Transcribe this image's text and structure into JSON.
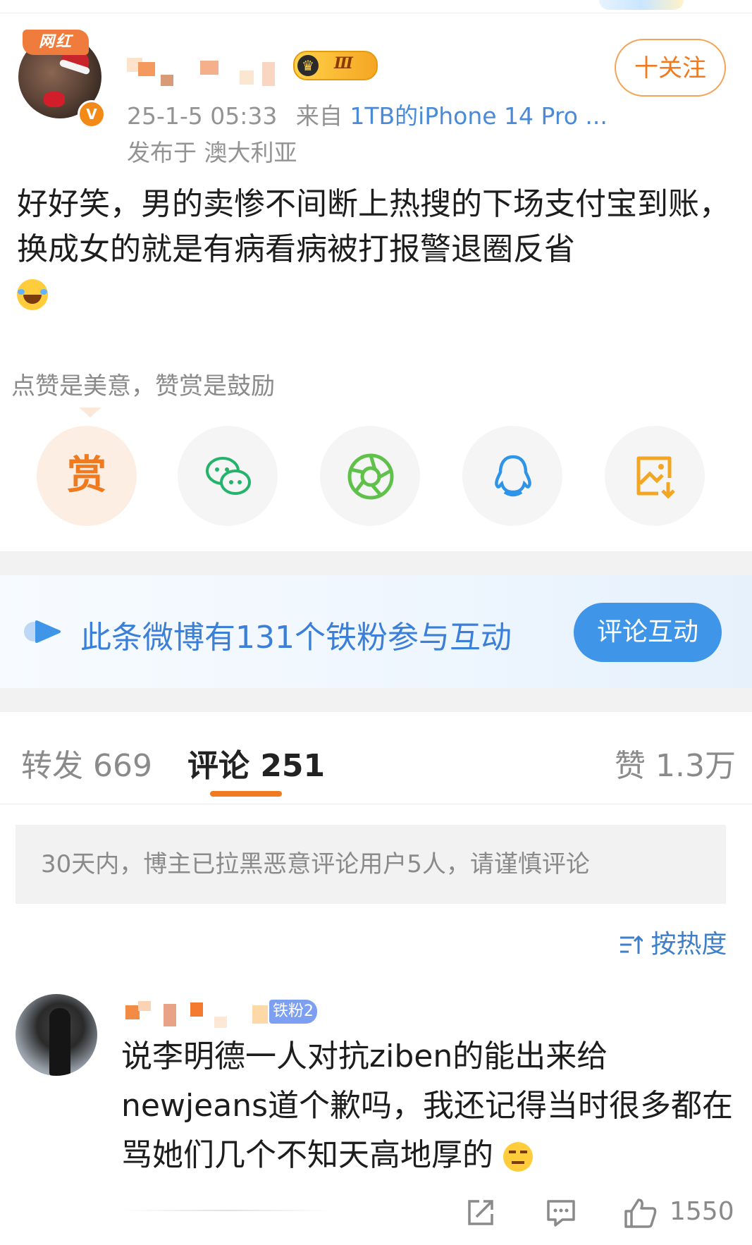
{
  "post": {
    "author_badge": "网红",
    "verified_mark": "V",
    "level_badge": "Ⅲ",
    "timestamp": "25-1-5 05:33",
    "source_prefix": "来自",
    "source": "1TB的iPhone 14 Pro ...",
    "location": "发布于 澳大利亚",
    "follow_label": "十关注",
    "text": "好好笑，男的卖惨不间断上热搜的下场支付宝到账，换成女的就是有病看病被打报警退圈反省"
  },
  "reward": {
    "hint": "点赞是美意，赞赏是鼓励",
    "reward_label": "赏",
    "share_targets": [
      "wechat-icon",
      "moments-icon",
      "qq-icon",
      "save-image-icon"
    ]
  },
  "fans_banner": {
    "text": "此条微博有131个铁粉参与互动",
    "button": "评论互动"
  },
  "tabs": {
    "repost": "转发 669",
    "comment": "评论 251",
    "like": "赞 1.3万"
  },
  "notice": "30天内，博主已拉黑恶意评论用户5人，请谨慎评论",
  "sort_label": "按热度",
  "comment": {
    "fan_badge": "铁粉2",
    "text": "说李明德一人对抗ziben的能出来给newjeans道个歉吗，我还记得当时很多都在骂她们几个不知天高地厚的",
    "like_count": "1550"
  },
  "colors": {
    "accent_orange": "#f07a1f",
    "link_blue": "#3b7fd8",
    "button_blue": "#3f95e8"
  }
}
